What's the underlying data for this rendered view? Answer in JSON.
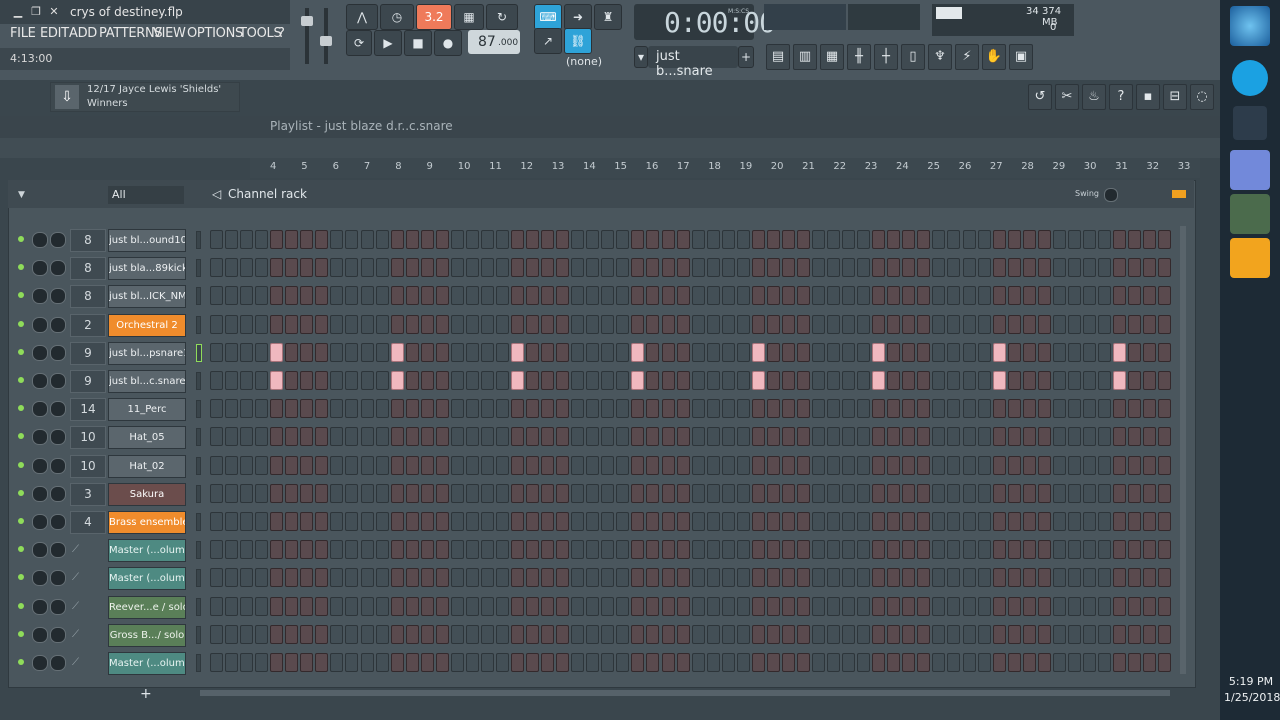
{
  "window": {
    "title": "crys of destiney.flp"
  },
  "menu": [
    "FILE",
    "EDIT",
    "ADD",
    "PATTERNS",
    "VIEW",
    "OPTIONS",
    "TOOLS",
    "?"
  ],
  "hint": "4:13:00",
  "transport": {
    "time": "0:00:00",
    "time_mode": "M:S:CS",
    "time_seconds": "00",
    "tempo": "87",
    "tempo_frac": ".000",
    "pattern": "just b...snare",
    "arrangement": "(none)",
    "pattern_index": "3.2"
  },
  "cpu": {
    "value": "34",
    "ram": "374 MB",
    "poly": "0"
  },
  "song_info": {
    "track": "12/17  Jayce Lewis 'Shields'",
    "album": "Winners"
  },
  "playlist": {
    "title": "Playlist - just blaze d.r..c.snare",
    "ticks": [
      "4",
      "5",
      "6",
      "7",
      "8",
      "9",
      "10",
      "11",
      "12",
      "13",
      "14",
      "15",
      "16",
      "17",
      "18",
      "19",
      "20",
      "21",
      "22",
      "23",
      "24",
      "25",
      "26",
      "27",
      "28",
      "29",
      "30",
      "31",
      "32",
      "33"
    ]
  },
  "channel_rack": {
    "title": "Channel rack",
    "filter": "All",
    "swing_label": "Swing",
    "channels": [
      {
        "num": "8",
        "name": "just bl...ound10",
        "color": "gray",
        "steps_on": []
      },
      {
        "num": "8",
        "name": "just bla...89kick",
        "color": "gray",
        "steps_on": []
      },
      {
        "num": "8",
        "name": "just bl...ICK_NM",
        "color": "gray",
        "steps_on": []
      },
      {
        "num": "2",
        "name": "Orchestral 2",
        "color": "orange",
        "steps_on": []
      },
      {
        "num": "9",
        "name": "just bl...psnare1",
        "color": "gray",
        "steps_on": [
          4,
          12,
          20,
          28,
          36,
          44,
          52,
          60
        ],
        "selected": true
      },
      {
        "num": "9",
        "name": "just bl...c.snare",
        "color": "gray",
        "steps_on": [
          4,
          12,
          20,
          28,
          36,
          44,
          52,
          60
        ]
      },
      {
        "num": "14",
        "name": "11_Perc",
        "color": "gray",
        "steps_on": []
      },
      {
        "num": "10",
        "name": "Hat_05",
        "color": "gray",
        "steps_on": []
      },
      {
        "num": "10",
        "name": "Hat_02",
        "color": "gray",
        "steps_on": []
      },
      {
        "num": "3",
        "name": "Sakura",
        "color": "sakura",
        "steps_on": []
      },
      {
        "num": "4",
        "name": "Brass ensemble",
        "color": "orange",
        "steps_on": []
      },
      {
        "num": "",
        "name": "Master (...olume",
        "color": "teal",
        "steps_on": []
      },
      {
        "num": "",
        "name": "Master (...olume",
        "color": "teal",
        "steps_on": []
      },
      {
        "num": "",
        "name": "Reever...e / solo",
        "color": "green",
        "steps_on": []
      },
      {
        "num": "",
        "name": "Gross B.../ solo",
        "color": "green",
        "steps_on": []
      },
      {
        "num": "",
        "name": "Master (...olume",
        "color": "teal",
        "steps_on": []
      }
    ],
    "add_label": "+"
  },
  "taskbar": {
    "time": "5:19 PM",
    "date": "1/25/2018"
  },
  "colors": {
    "accent": "#ef7a5a",
    "blue": "#2ea3d8",
    "step_on": "#f0b8bf"
  }
}
